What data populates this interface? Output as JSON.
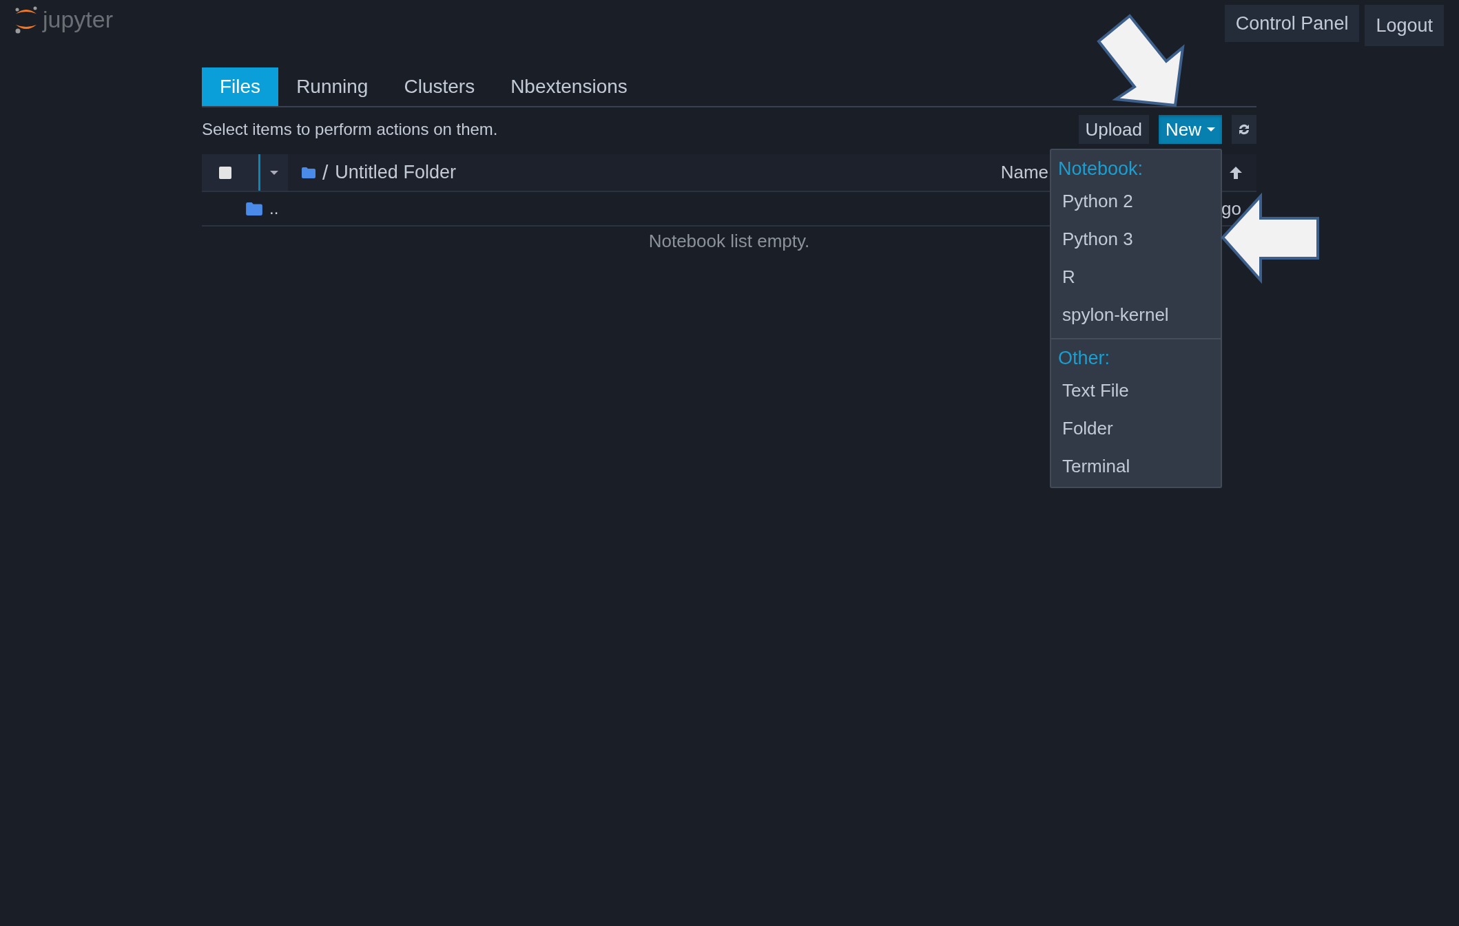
{
  "header": {
    "logo_text": "jupyter",
    "buttons": [
      "Control Panel",
      "Logout"
    ]
  },
  "tabs": [
    {
      "label": "Files",
      "selected": true
    },
    {
      "label": "Running",
      "selected": false
    },
    {
      "label": "Clusters",
      "selected": false
    },
    {
      "label": "Nbextensions",
      "selected": false
    }
  ],
  "toolbar": {
    "hint": "Select items to perform actions on them.",
    "buttons": [
      {
        "kind": "plain",
        "label": "Upload"
      },
      {
        "kind": "dropdown",
        "label": "New",
        "expanded": true
      },
      {
        "kind": "refresh"
      }
    ]
  },
  "file_list": {
    "select_all_checked": false,
    "path_separator": "/",
    "path": "Untitled Folder",
    "sort_label": "Name",
    "rows": [
      {
        "name": "..",
        "modified": "go"
      }
    ],
    "empty_message": "Notebook list empty."
  },
  "new_menu": {
    "sections": [
      {
        "heading": "Notebook:",
        "items": [
          "Python 2",
          "Python 3",
          "R",
          "spylon-kernel"
        ]
      },
      {
        "heading": "Other:",
        "items": [
          "Text File",
          "Folder",
          "Terminal"
        ]
      }
    ]
  }
}
